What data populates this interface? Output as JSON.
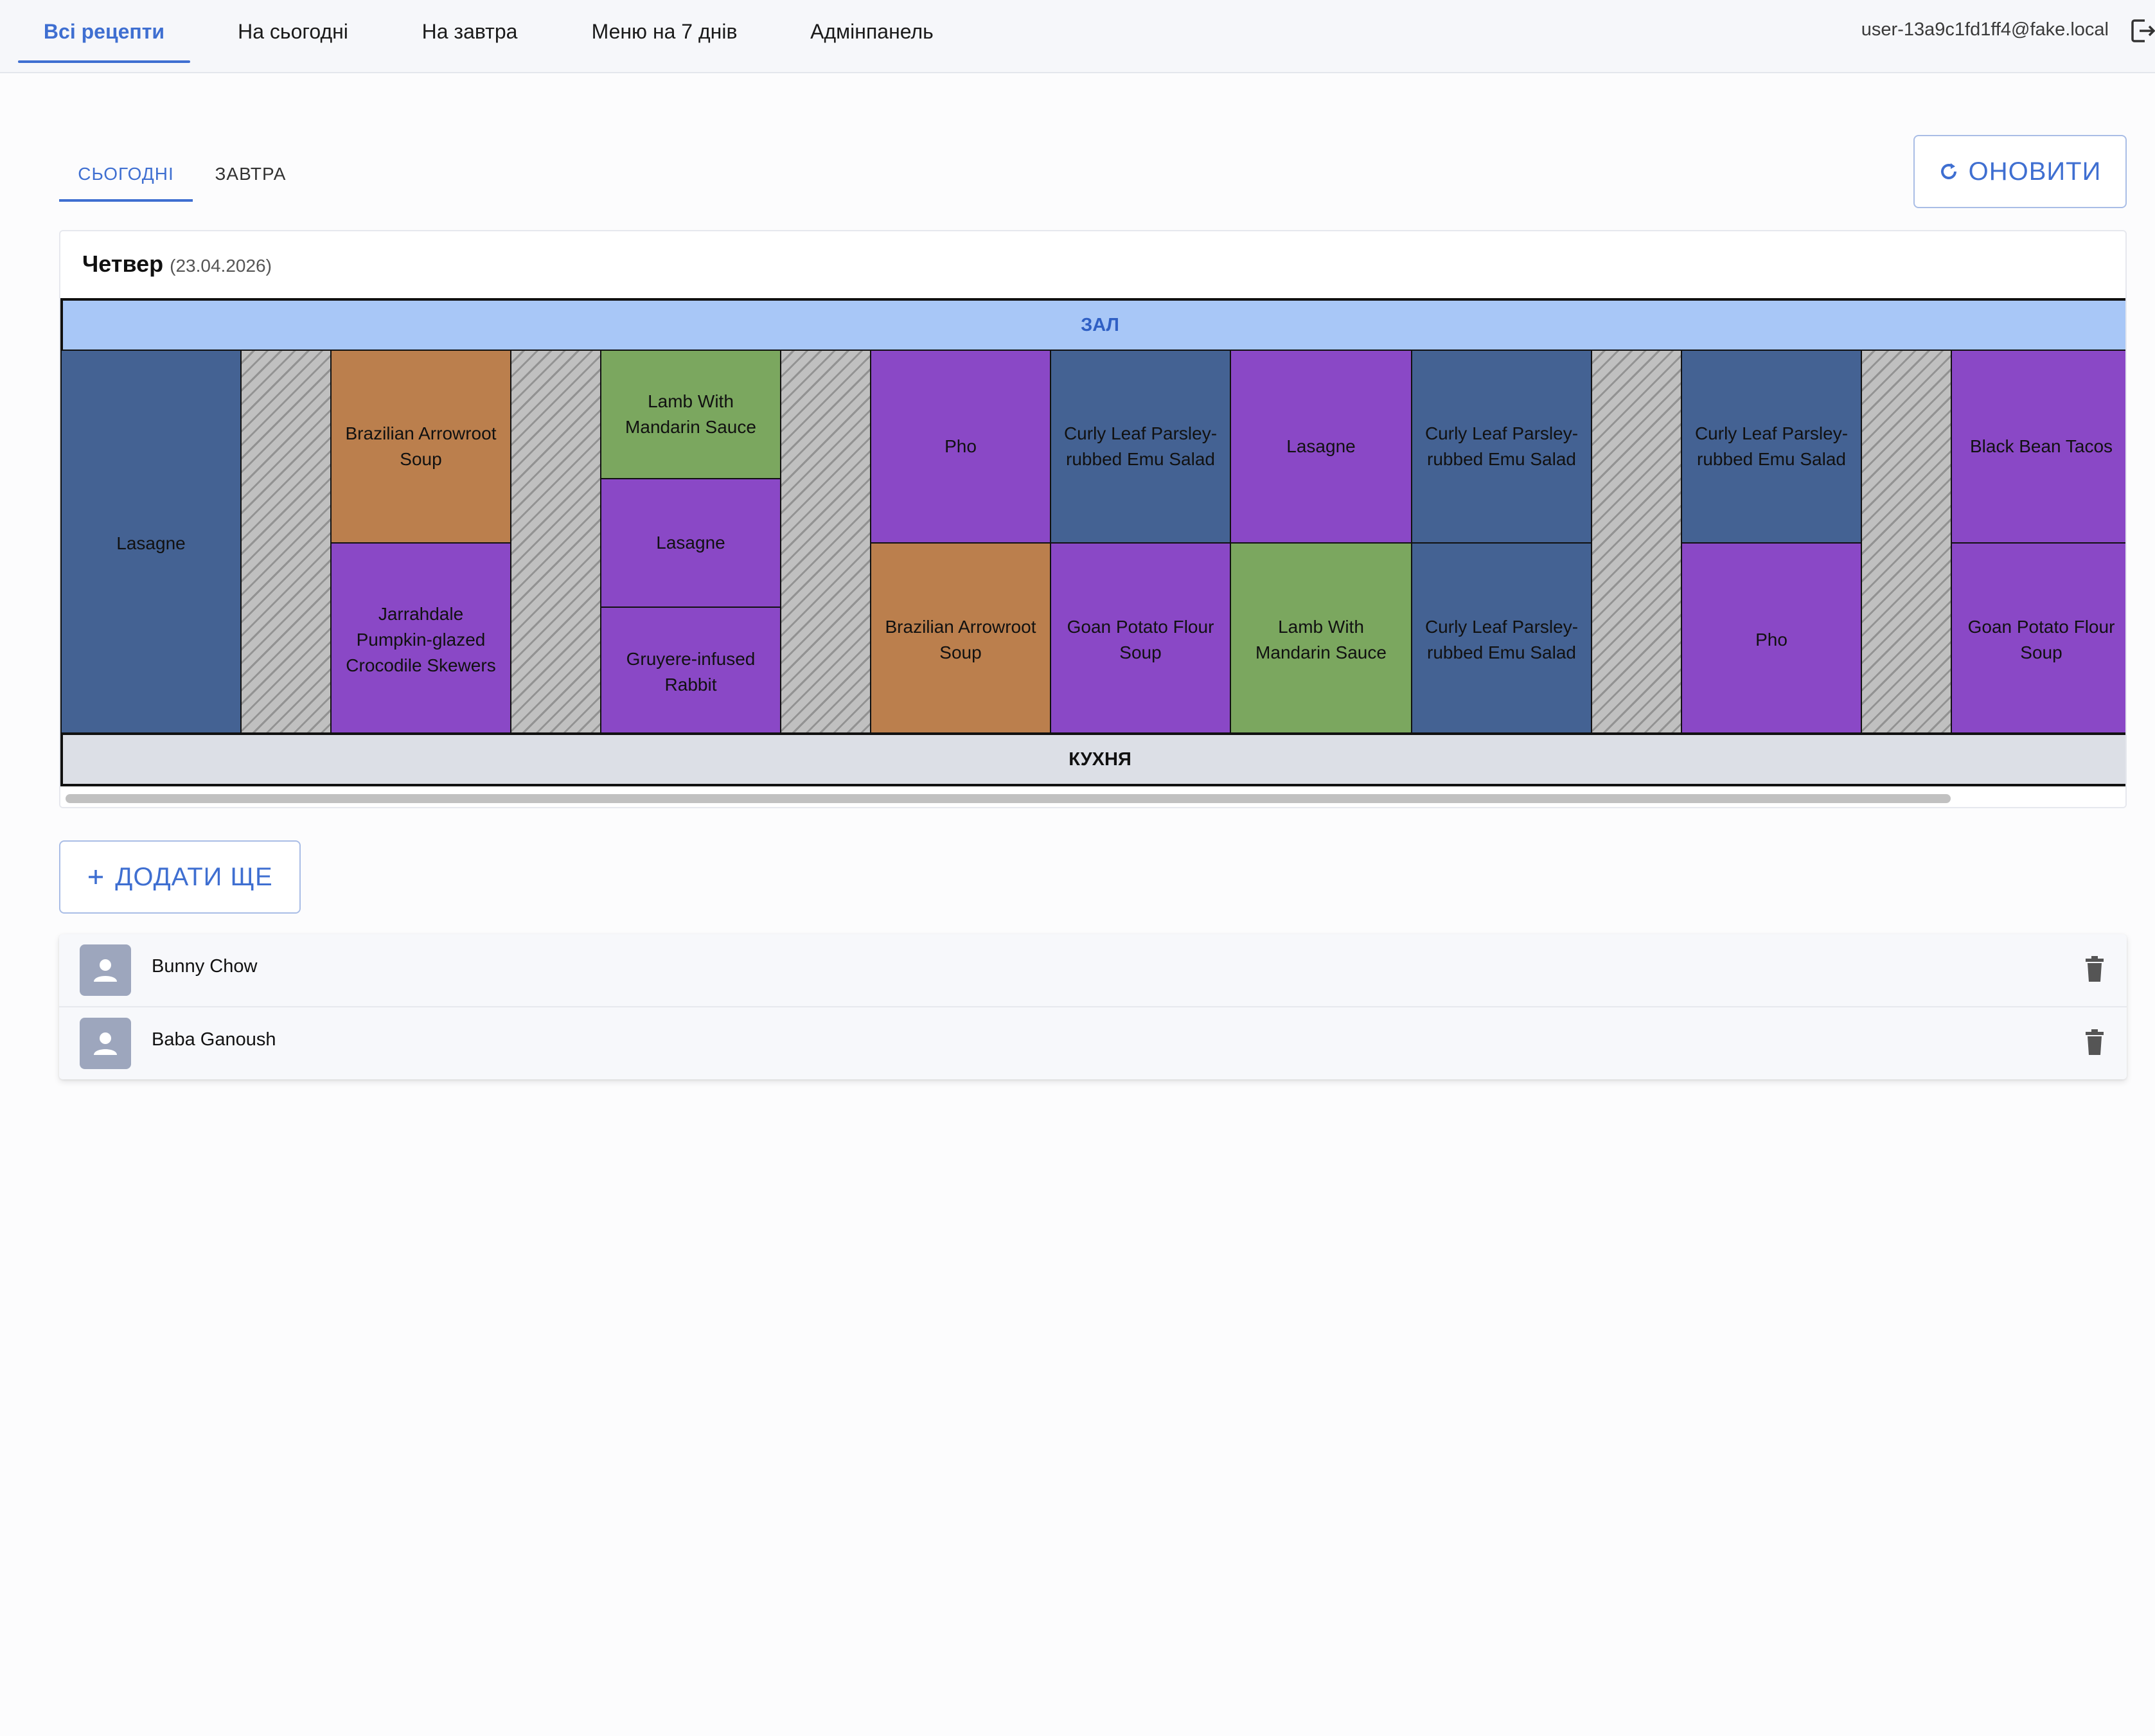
{
  "nav": {
    "tabs": [
      {
        "label": "Всі рецепти"
      },
      {
        "label": "На сьогодні"
      },
      {
        "label": "На завтра"
      },
      {
        "label": "Меню на 7 днів"
      },
      {
        "label": "Адмінпанель"
      }
    ],
    "user_email": "user-13a9c1fd1ff4@fake.local"
  },
  "subtabs": [
    {
      "label": "СЬОГОДНІ"
    },
    {
      "label": "ЗАВТРА"
    }
  ],
  "refresh_label": "ОНОВИТИ",
  "schedule": {
    "day": "Четвер",
    "date": "(23.04.2026)",
    "hall_label": "ЗАЛ",
    "kitchen_label": "КУХНЯ",
    "cells": [
      {
        "label": "Lasagne",
        "color": "#446293"
      },
      {
        "label": "",
        "color": "#c0c0c0"
      },
      {
        "label": "Brazilian Arrowroot Soup",
        "color": "#bb7f4d"
      },
      {
        "label": "Jarrahdale Pumpkin-glazed Crocodile Skewers",
        "color": "#8a48c6"
      },
      {
        "label": "",
        "color": "#c0c0c0"
      },
      {
        "label": "Lamb With Mandarin Sauce",
        "color": "#7ba75f"
      },
      {
        "label": "Lasagne",
        "color": "#8a48c6"
      },
      {
        "label": "Gruyere-infused Rabbit",
        "color": "#8a48c6"
      },
      {
        "label": "",
        "color": "#c0c0c0"
      },
      {
        "label": "Pho",
        "color": "#8a48c6"
      },
      {
        "label": "Brazilian Arrowroot Soup",
        "color": "#bb7f4d"
      },
      {
        "label": "Curly Leaf Parsley-rubbed Emu Salad",
        "color": "#446293"
      },
      {
        "label": "Goan Potato Flour Soup",
        "color": "#8a48c6"
      },
      {
        "label": "Lasagne",
        "color": "#8a48c6"
      },
      {
        "label": "Lamb With Mandarin Sauce",
        "color": "#7ba75f"
      },
      {
        "label": "Curly Leaf Parsley-rubbed Emu Salad",
        "color": "#446293"
      },
      {
        "label": "Curly Leaf Parsley-rubbed Emu Salad",
        "color": "#446293"
      },
      {
        "label": "",
        "color": "#c0c0c0"
      },
      {
        "label": "Curly Leaf Parsley-rubbed Emu Salad",
        "color": "#446293"
      },
      {
        "label": "Pho",
        "color": "#8a48c6"
      },
      {
        "label": "",
        "color": "#c0c0c0"
      },
      {
        "label": "Black Bean Tacos",
        "color": "#8a48c6"
      },
      {
        "label": "Goan Potato Flour Soup",
        "color": "#8a48c6"
      }
    ]
  },
  "add_more_label": "ДОДАТИ ЩЕ",
  "list": [
    {
      "label": "Bunny Chow"
    },
    {
      "label": "Baba Ganoush"
    }
  ]
}
